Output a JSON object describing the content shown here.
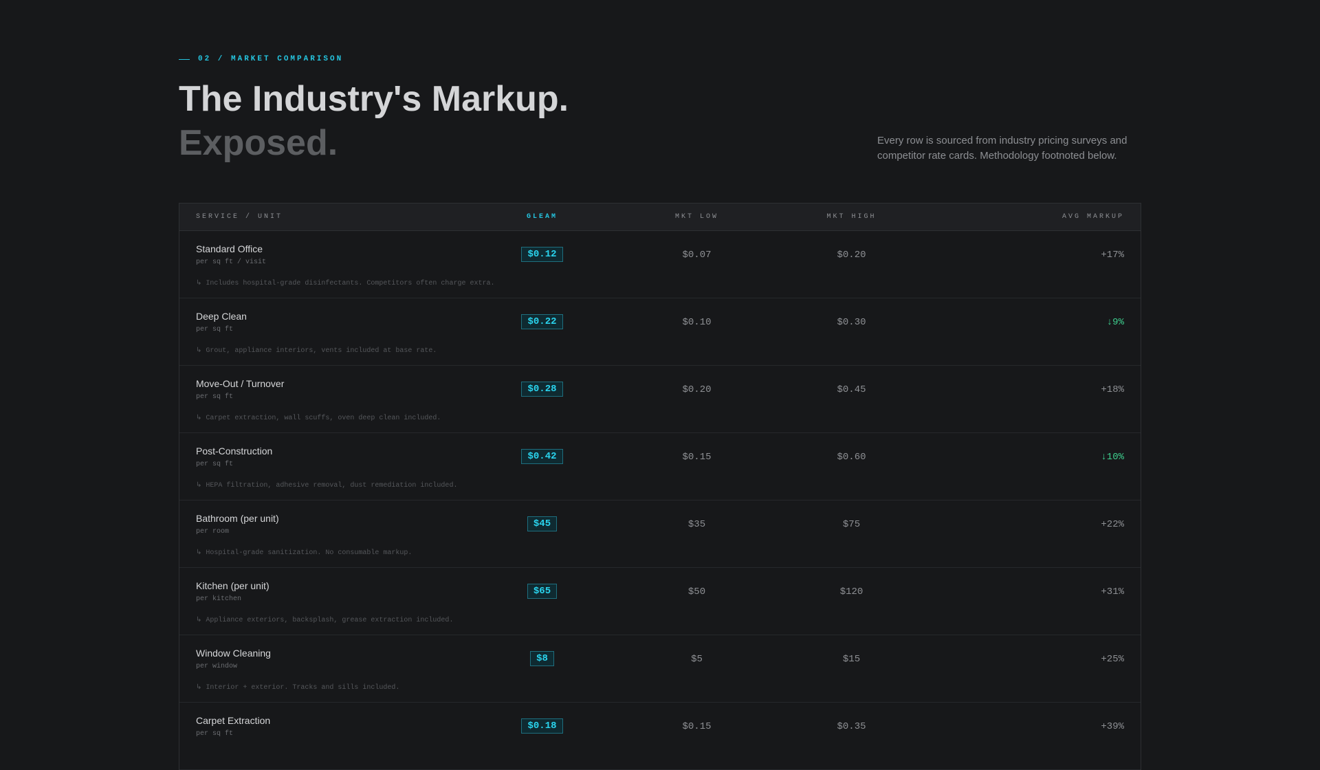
{
  "section": {
    "eyebrow": "02 / MARKET COMPARISON"
  },
  "headline": {
    "line1": "The Industry's Markup.",
    "line2": "Exposed."
  },
  "intro_note": "Every row is sourced from industry pricing surveys and competitor rate cards. Methodology footnoted below.",
  "table": {
    "headers": {
      "service": "SERVICE / UNIT",
      "gleam": "GLEAM",
      "mkt_low": "MKT LOW",
      "mkt_high": "MKT HIGH",
      "avg_markup": "AVG MARKUP"
    },
    "rows": [
      {
        "name": "Standard Office",
        "unit": "per sq ft / visit",
        "desc": "↳ Includes hospital-grade disinfectants. Competitors often charge extra.",
        "gleam": "$0.12",
        "low": "$0.07",
        "high": "$0.20",
        "markup": "+17%",
        "trend": "up"
      },
      {
        "name": "Deep Clean",
        "unit": "per sq ft",
        "desc": "↳ Grout, appliance interiors, vents included at base rate.",
        "gleam": "$0.22",
        "low": "$0.10",
        "high": "$0.30",
        "markup": "↓9%",
        "trend": "down"
      },
      {
        "name": "Move-Out / Turnover",
        "unit": "per sq ft",
        "desc": "↳ Carpet extraction, wall scuffs, oven deep clean included.",
        "gleam": "$0.28",
        "low": "$0.20",
        "high": "$0.45",
        "markup": "+18%",
        "trend": "up"
      },
      {
        "name": "Post-Construction",
        "unit": "per sq ft",
        "desc": "↳ HEPA filtration, adhesive removal, dust remediation included.",
        "gleam": "$0.42",
        "low": "$0.15",
        "high": "$0.60",
        "markup": "↓10%",
        "trend": "down"
      },
      {
        "name": "Bathroom (per unit)",
        "unit": "per room",
        "desc": "↳ Hospital-grade sanitization. No consumable markup.",
        "gleam": "$45",
        "low": "$35",
        "high": "$75",
        "markup": "+22%",
        "trend": "up"
      },
      {
        "name": "Kitchen (per unit)",
        "unit": "per kitchen",
        "desc": "↳ Appliance exteriors, backsplash, grease extraction included.",
        "gleam": "$65",
        "low": "$50",
        "high": "$120",
        "markup": "+31%",
        "trend": "up"
      },
      {
        "name": "Window Cleaning",
        "unit": "per window",
        "desc": "↳ Interior + exterior. Tracks and sills included.",
        "gleam": "$8",
        "low": "$5",
        "high": "$15",
        "markup": "+25%",
        "trend": "up"
      },
      {
        "name": "Carpet Extraction",
        "unit": "per sq ft",
        "desc": "",
        "gleam": "$0.18",
        "low": "$0.15",
        "high": "$0.35",
        "markup": "+39%",
        "trend": "up"
      }
    ]
  },
  "colors": {
    "accent": "#25c5e0",
    "positive": "#3ecf8e",
    "background": "#17181a"
  }
}
